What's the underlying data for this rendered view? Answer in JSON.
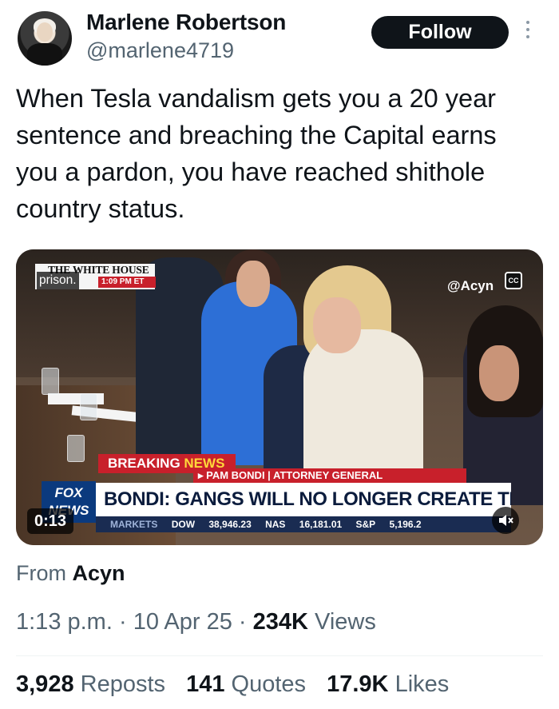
{
  "author": {
    "name": "Marlene Robertson",
    "handle": "@marlene4719",
    "avatar_icon": "profile-photo"
  },
  "follow_label": "Follow",
  "more_icon": "more-vertical-icon",
  "tweet": {
    "text": "When Tesla vandalism gets you a  20 year sentence and breaching the Capital earns you a pardon, you have reached shithole country status."
  },
  "video": {
    "source_overlay": "THE WHITE HOUSE",
    "source_time": "1:09 PM ET",
    "caption": "prison.",
    "watermark": "@Acyn",
    "cc_label": "CC",
    "breaking_a": "BREAKING",
    "breaking_b": "NEWS",
    "subtitle": "▸ PAM BONDI | ATTORNEY GENERAL",
    "headline": "BONDI: GANGS WILL NO LONGER CREATE TERROR",
    "network_line1": "FOX",
    "network_line2": "NEWS",
    "ticker": {
      "markets": "MARKETS",
      "dow": "DOW",
      "dow_value": "38,946.23",
      "nas": "NAS",
      "nas_value": "16,181.01",
      "sp": "S&P",
      "sp_value": "5,196.2"
    },
    "timer": "0:13",
    "mute_icon": "volume-mute-icon"
  },
  "from": {
    "prefix": "From",
    "source": "Acyn"
  },
  "meta": {
    "time": "1:13 p.m.",
    "sep1": "·",
    "date": "10 Apr 25",
    "sep2": "·",
    "views_count": "234K",
    "views_label": "Views"
  },
  "stats": {
    "reposts_count": "3,928",
    "reposts_label": "Reposts",
    "quotes_count": "141",
    "quotes_label": "Quotes",
    "likes_count": "17.9K",
    "likes_label": "Likes"
  },
  "colors": {
    "text": "#0f1419",
    "secondary": "#536471",
    "fox_red": "#c8202b",
    "fox_blue": "#0b3a7e"
  }
}
